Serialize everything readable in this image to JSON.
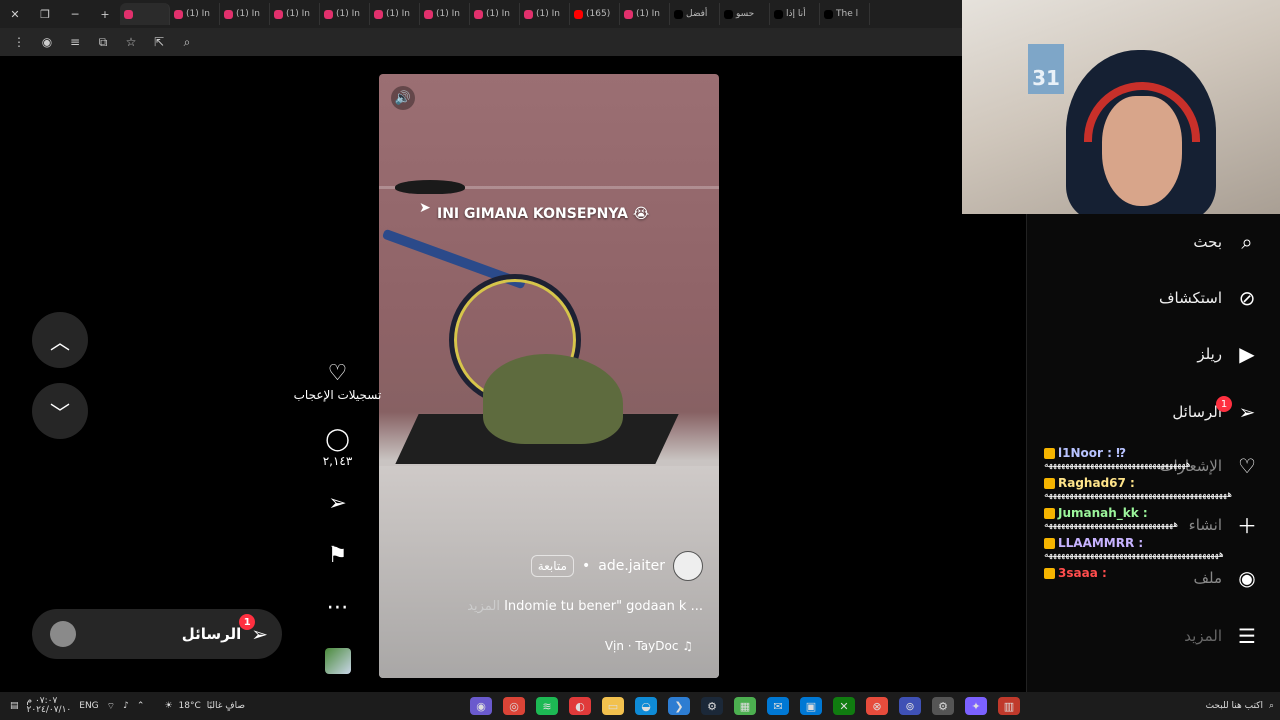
{
  "browser": {
    "tabs": [
      {
        "label": "",
        "color": "#e1306c",
        "active": true
      },
      {
        "label": "(1) In",
        "color": "#e1306c"
      },
      {
        "label": "(1) In",
        "color": "#e1306c"
      },
      {
        "label": "(1) In",
        "color": "#e1306c"
      },
      {
        "label": "(1) In",
        "color": "#e1306c"
      },
      {
        "label": "(1) In",
        "color": "#e1306c"
      },
      {
        "label": "(1) In",
        "color": "#e1306c"
      },
      {
        "label": "(1) In",
        "color": "#e1306c"
      },
      {
        "label": "(1) In",
        "color": "#e1306c"
      },
      {
        "label": "(165)",
        "color": "#ff0000"
      },
      {
        "label": "(1) In",
        "color": "#e1306c"
      },
      {
        "label": "أفضل",
        "color": "#000000"
      },
      {
        "label": "حسو",
        "color": "#000000"
      },
      {
        "label": "أنا إذا",
        "color": "#000000"
      },
      {
        "label": "The l",
        "color": "#000000"
      }
    ]
  },
  "reel": {
    "caption": "INI GIMANA KONSEPNYA 😭",
    "author": "ade.jaiter",
    "follow_label": "متابعة",
    "description": "Indomie tu bener\" godaan k ...",
    "more_label": "المزيد",
    "audio": "Vịn · TayDoc ♫"
  },
  "actions": {
    "like_label": "تسجيلات الإعجاب",
    "comment_count": "٢,١٤٣"
  },
  "messages_pill": {
    "label": "الرسائل",
    "badge": "1"
  },
  "sidebar": {
    "search": "بحث",
    "explore": "استكشاف",
    "reels": "ريلز",
    "messages": "الرسائل",
    "messages_badge": "1",
    "notifications": "الإشعارات",
    "create": "انشاء",
    "profile": "ملف",
    "more": "المزيد"
  },
  "chat": [
    {
      "user": "l1Noor : ⁉",
      "color": "#b8c3ff",
      "msg": "ههههههههههههههههههههههههههههههههههه"
    },
    {
      "user": "Raghad67 :",
      "color": "#ffe48a",
      "msg": "ههههههههههههههههههههههههههههههههههههههههههههه"
    },
    {
      "user": "Jumanah_kk :",
      "color": "#9bf59b",
      "msg": "هههههههههههههههههههههههههههههههه"
    },
    {
      "user": "LLAAMMRR :",
      "color": "#c7b3ff",
      "msg": "ههههههههههههههههههههههههههههههههههههههههههه"
    },
    {
      "user": "3saaa :",
      "color": "#ff4d4d",
      "msg": ""
    }
  ],
  "taskbar": {
    "time": "٠٧:٠٧ م",
    "date": "٢٠٢٤/٠٧/١٠",
    "lang": "ENG",
    "temp": "18°C",
    "weather": "صافٍ غالبًا",
    "search_placeholder": "اكتب هنا للبحث"
  }
}
